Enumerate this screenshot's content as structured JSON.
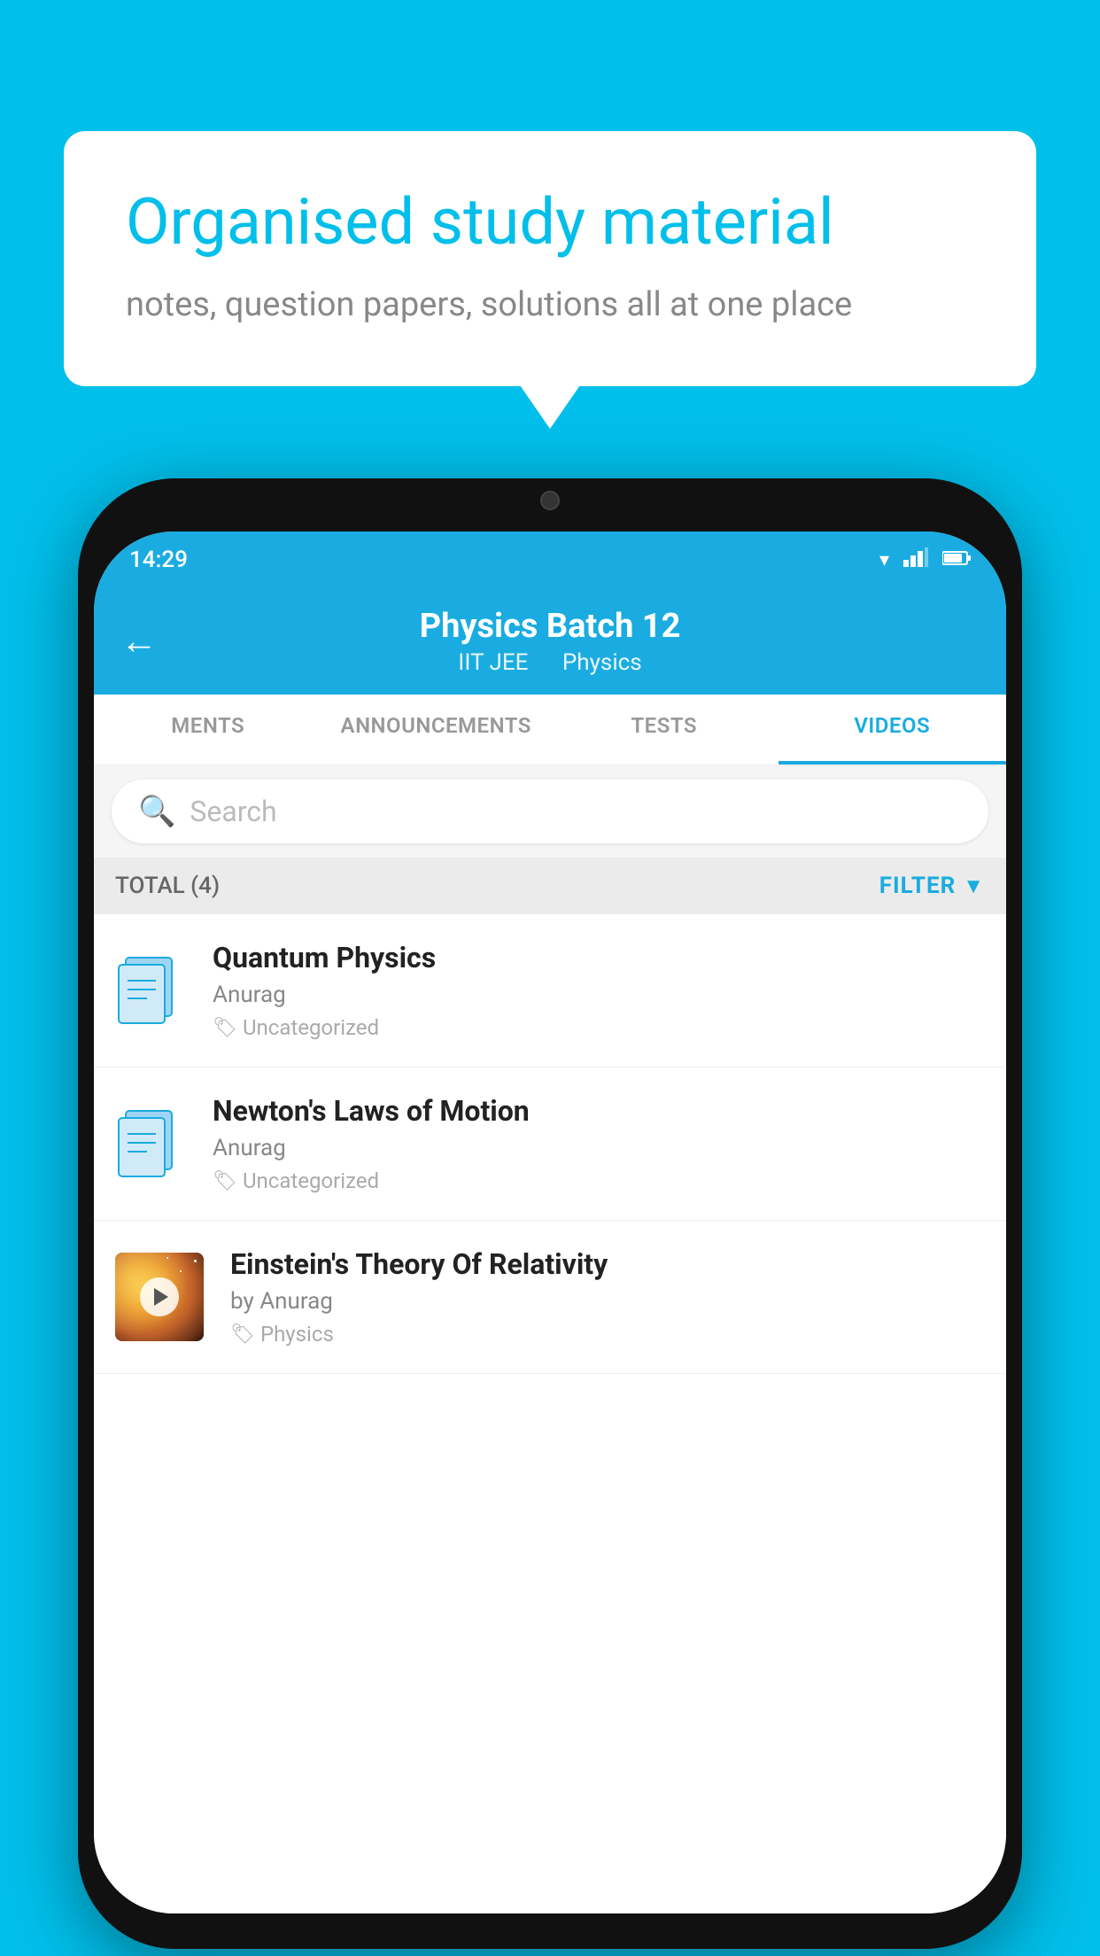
{
  "background_color": "#00BFEA",
  "speech_bubble": {
    "title": "Organised study material",
    "subtitle": "notes, question papers, solutions all at one place"
  },
  "status_bar": {
    "time": "14:29",
    "icons": [
      "wifi",
      "signal",
      "battery"
    ]
  },
  "app_header": {
    "back_label": "←",
    "title": "Physics Batch 12",
    "subtitle_part1": "IIT JEE",
    "subtitle_part2": "Physics"
  },
  "tabs": [
    {
      "label": "MENTS",
      "active": false
    },
    {
      "label": "ANNOUNCEMENTS",
      "active": false
    },
    {
      "label": "TESTS",
      "active": false
    },
    {
      "label": "VIDEOS",
      "active": true
    }
  ],
  "search": {
    "placeholder": "Search"
  },
  "filter_bar": {
    "total_label": "TOTAL (4)",
    "filter_label": "FILTER"
  },
  "video_items": [
    {
      "id": 1,
      "title": "Quantum Physics",
      "author": "Anurag",
      "tag": "Uncategorized",
      "type": "file",
      "has_thumbnail": false
    },
    {
      "id": 2,
      "title": "Newton's Laws of Motion",
      "author": "Anurag",
      "tag": "Uncategorized",
      "type": "file",
      "has_thumbnail": false
    },
    {
      "id": 3,
      "title": "Einstein's Theory Of Relativity",
      "author": "by Anurag",
      "tag": "Physics",
      "type": "video",
      "has_thumbnail": true
    }
  ]
}
